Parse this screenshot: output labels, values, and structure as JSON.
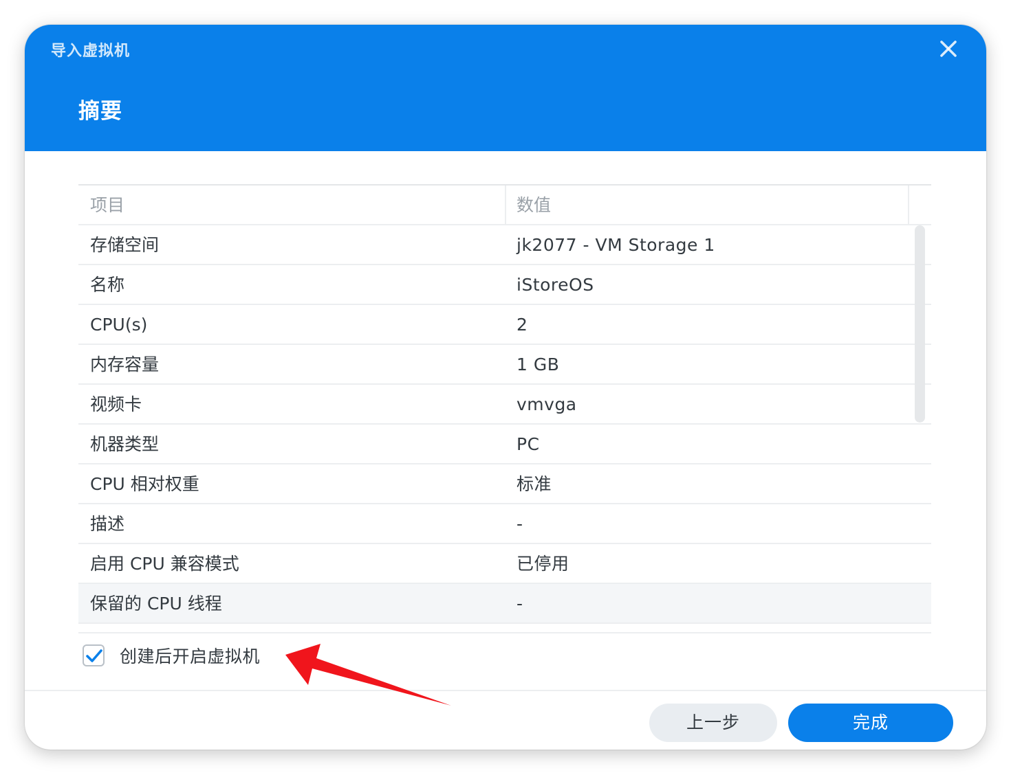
{
  "dialog": {
    "window_title": "导入虚拟机",
    "step_title": "摘要"
  },
  "table": {
    "headers": {
      "item": "项目",
      "value": "数值"
    },
    "rows": [
      {
        "item": "存储空间",
        "value": "jk2077 - VM Storage 1"
      },
      {
        "item": "名称",
        "value": "iStoreOS"
      },
      {
        "item": "CPU(s)",
        "value": "2"
      },
      {
        "item": "内存容量",
        "value": "1 GB"
      },
      {
        "item": "视频卡",
        "value": "vmvga"
      },
      {
        "item": "机器类型",
        "value": "PC"
      },
      {
        "item": "CPU 相对权重",
        "value": "标准"
      },
      {
        "item": "描述",
        "value": "-"
      },
      {
        "item": "启用 CPU 兼容模式",
        "value": "已停用"
      },
      {
        "item": "保留的 CPU 线程",
        "value": "-"
      }
    ]
  },
  "options": {
    "start_after_create_label": "创建后开启虚拟机",
    "start_after_create_checked": true
  },
  "footer": {
    "prev_label": "上一步",
    "finish_label": "完成"
  },
  "icons": {
    "close": "close-icon",
    "check": "check-icon",
    "annotation": "arrow-annotation"
  },
  "colors": {
    "accent": "#0a80ea",
    "annotation": "#f0151c"
  }
}
